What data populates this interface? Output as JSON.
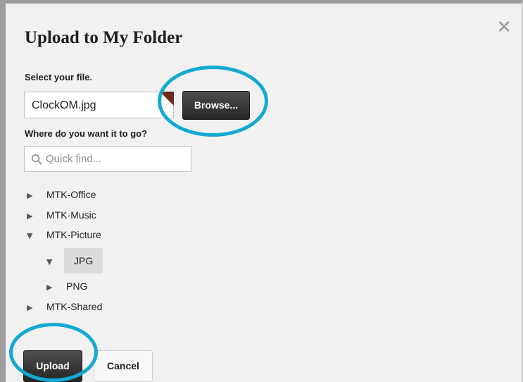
{
  "dialog": {
    "title": "Upload to My Folder",
    "close_icon": "close-icon"
  },
  "file": {
    "label": "Select your file.",
    "value": "ClockOM.jpg",
    "browse_label": "Browse..."
  },
  "destination": {
    "label": "Where do you want it to go?",
    "search_placeholder": "Quick find...",
    "search_icon": "search-icon",
    "tree": [
      {
        "label": "MTK-Office",
        "expanded": false,
        "icon": "chevron-right-icon"
      },
      {
        "label": "MTK-Music",
        "expanded": false,
        "icon": "chevron-right-icon"
      },
      {
        "label": "MTK-Picture",
        "expanded": true,
        "icon": "chevron-down-icon"
      },
      {
        "label": "JPG",
        "expanded": true,
        "selected": true,
        "icon": "chevron-down-icon"
      },
      {
        "label": "PNG",
        "expanded": false,
        "icon": "chevron-right-icon"
      },
      {
        "label": "MTK-Shared",
        "expanded": false,
        "icon": "chevron-right-icon"
      }
    ]
  },
  "actions": {
    "upload_label": "Upload",
    "cancel_label": "Cancel"
  },
  "colors": {
    "callout": "#12a9d3",
    "dialog_bg": "#f1f1f1",
    "button_dark": "#333333"
  }
}
